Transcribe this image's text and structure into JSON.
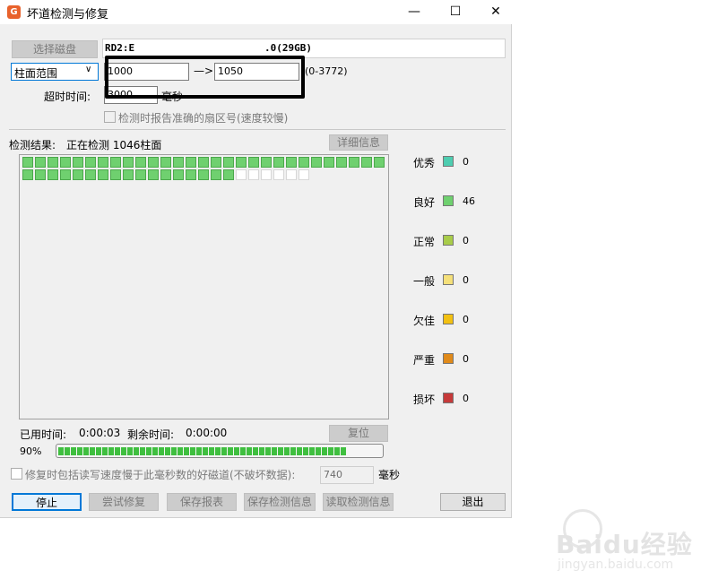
{
  "window": {
    "title": "坏道检测与修复"
  },
  "titlebar": {
    "minimize": "—",
    "maximize": "☐",
    "close": "✕"
  },
  "top": {
    "select_disk_label": "选择磁盘",
    "disk_info_prefix": "RD2:E",
    "disk_info_suffix": ".0(29GB)",
    "range_mode": "柱面范围",
    "range_start": "1000",
    "range_arrow": "—>",
    "range_end": "1050",
    "range_hint": "(0-3772)",
    "timeout_label": "超时时间:",
    "timeout_value": "3000",
    "timeout_unit": "毫秒",
    "report_accurate_label": "检测时报告准确的扇区号(速度较慢)"
  },
  "result": {
    "label": "检测结果:",
    "status": "正在检测 1046柱面",
    "detail_button": "详细信息",
    "good_cells": 46,
    "empty_cells": 6
  },
  "legend": [
    {
      "label": "优秀",
      "color": "#4ecdb0",
      "count": "0"
    },
    {
      "label": "良好",
      "color": "#6fd06f",
      "count": "46"
    },
    {
      "label": "正常",
      "color": "#a8cc4a",
      "count": "0"
    },
    {
      "label": "一般",
      "color": "#f5e07a",
      "count": "0"
    },
    {
      "label": "欠佳",
      "color": "#f2c012",
      "count": "0"
    },
    {
      "label": "严重",
      "color": "#e08a1a",
      "count": "0"
    },
    {
      "label": "损坏",
      "color": "#c63a3a",
      "count": "0"
    }
  ],
  "time": {
    "elapsed_label": "已用时间:",
    "elapsed_value": "0:00:03",
    "remaining_label": "剩余时间:",
    "remaining_value": "0:00:00",
    "reset_button": "复位"
  },
  "progress": {
    "percent_label": "90%",
    "fraction": 0.9
  },
  "repair": {
    "slow_track_label": "修复时包括读写速度慢于此毫秒数的好磁道(不破坏数据):",
    "slow_value": "740",
    "unit": "毫秒"
  },
  "buttons": {
    "stop": "停止",
    "try_repair": "尝试修复",
    "save_report": "保存报表",
    "save_info": "保存检测信息",
    "load_info": "读取检测信息",
    "exit": "退出"
  },
  "watermark": {
    "brand": "Baidu经验",
    "url": "jingyan.baidu.com"
  }
}
